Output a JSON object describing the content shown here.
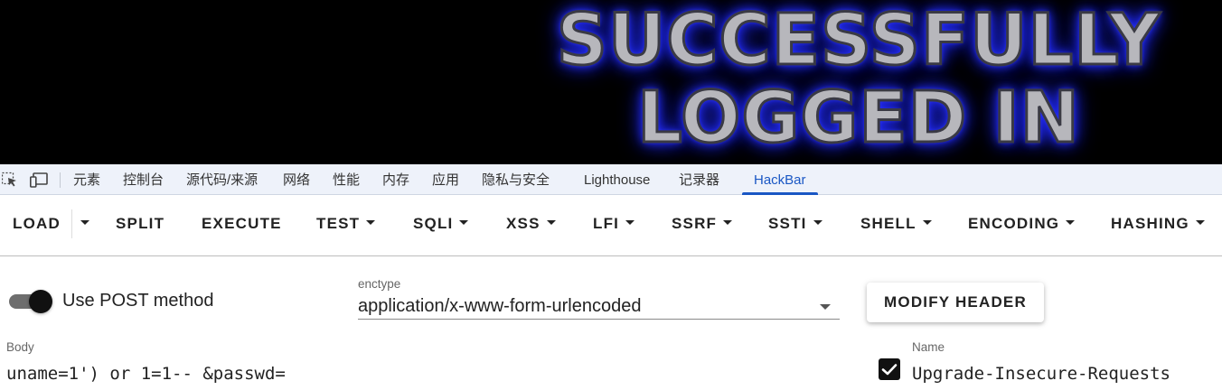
{
  "banner": {
    "line1": "SUCCESSFULLY",
    "line2": "LOGGED IN",
    "glow_color": "#2a33ff"
  },
  "devtools": {
    "icons": [
      "inspect-element-icon",
      "device-toolbar-icon"
    ],
    "tabs": [
      {
        "label": "元素"
      },
      {
        "label": "控制台"
      },
      {
        "label": "源代码/来源"
      },
      {
        "label": "网络"
      },
      {
        "label": "性能"
      },
      {
        "label": "内存"
      },
      {
        "label": "应用"
      },
      {
        "label": "隐私与安全"
      },
      {
        "label": "Lighthouse"
      },
      {
        "label": "记录器"
      },
      {
        "label": "HackBar",
        "active": true
      }
    ],
    "accent": "#1a57c4"
  },
  "toolbar": {
    "items": [
      {
        "label": "LOAD"
      },
      {
        "label": "SPLIT"
      },
      {
        "label": "EXECUTE"
      },
      {
        "label": "TEST"
      },
      {
        "label": "SQLI"
      },
      {
        "label": "XSS"
      },
      {
        "label": "LFI"
      },
      {
        "label": "SSRF"
      },
      {
        "label": "SSTI"
      },
      {
        "label": "SHELL"
      },
      {
        "label": "ENCODING"
      },
      {
        "label": "HASHING"
      }
    ]
  },
  "form": {
    "post_label": "Use POST method",
    "post_enabled": true,
    "enctype_label": "enctype",
    "enctype_value": "application/x-www-form-urlencoded",
    "modify_header_label": "MODIFY HEADER",
    "body_label": "Body",
    "body_value": "uname=1') or 1=1-- &passwd=",
    "header_checked": true,
    "name_label": "Name",
    "name_value": "Upgrade-Insecure-Requests"
  }
}
